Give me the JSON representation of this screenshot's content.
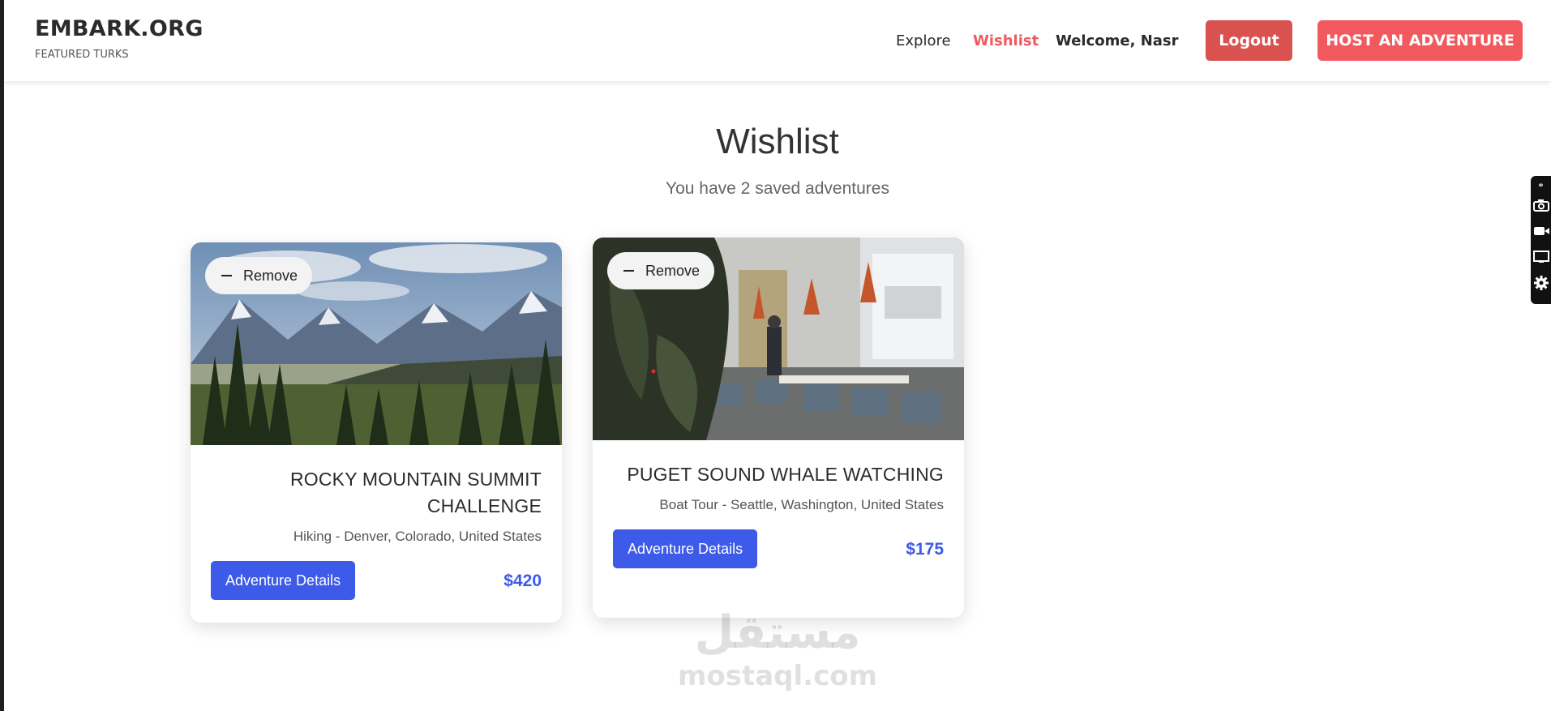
{
  "header": {
    "brand_title": "EMBARK.ORG",
    "brand_subtitle": "FEATURED TURKS",
    "nav": {
      "explore": "Explore",
      "wishlist": "Wishlist",
      "welcome": "Welcome, Nasr"
    },
    "logout_label": "Logout",
    "host_label": "HOST AN ADVENTURE"
  },
  "main": {
    "title": "Wishlist",
    "subtitle": "You have 2 saved adventures",
    "cards": [
      {
        "remove_label": "Remove",
        "title_line1": "ROCKY MOUNTAIN SUMMIT",
        "title_line2": "CHALLENGE",
        "location": "Hiking - Denver, Colorado, United States",
        "details_label": "Adventure Details",
        "price": "$420",
        "image": "mountain-landscape"
      },
      {
        "remove_label": "Remove",
        "title_line1": "PUGET SOUND WHALE WATCHING",
        "title_line2": "",
        "location": "Boat Tour - Seattle, Washington, United States",
        "details_label": "Adventure Details",
        "price": "$175",
        "image": "restaurant-interior"
      }
    ]
  },
  "watermark": {
    "arabic": "مستقل",
    "latin": "mostaql.com"
  },
  "side_toolbar": {
    "icons": [
      "link-icon",
      "camera-icon",
      "video-icon",
      "screen-icon",
      "gear-icon"
    ]
  },
  "colors": {
    "accent_red": "#f2595f",
    "logout_red": "#d9524f",
    "primary_blue": "#3d5ae8",
    "wishlist_active": "#f05a5f"
  }
}
